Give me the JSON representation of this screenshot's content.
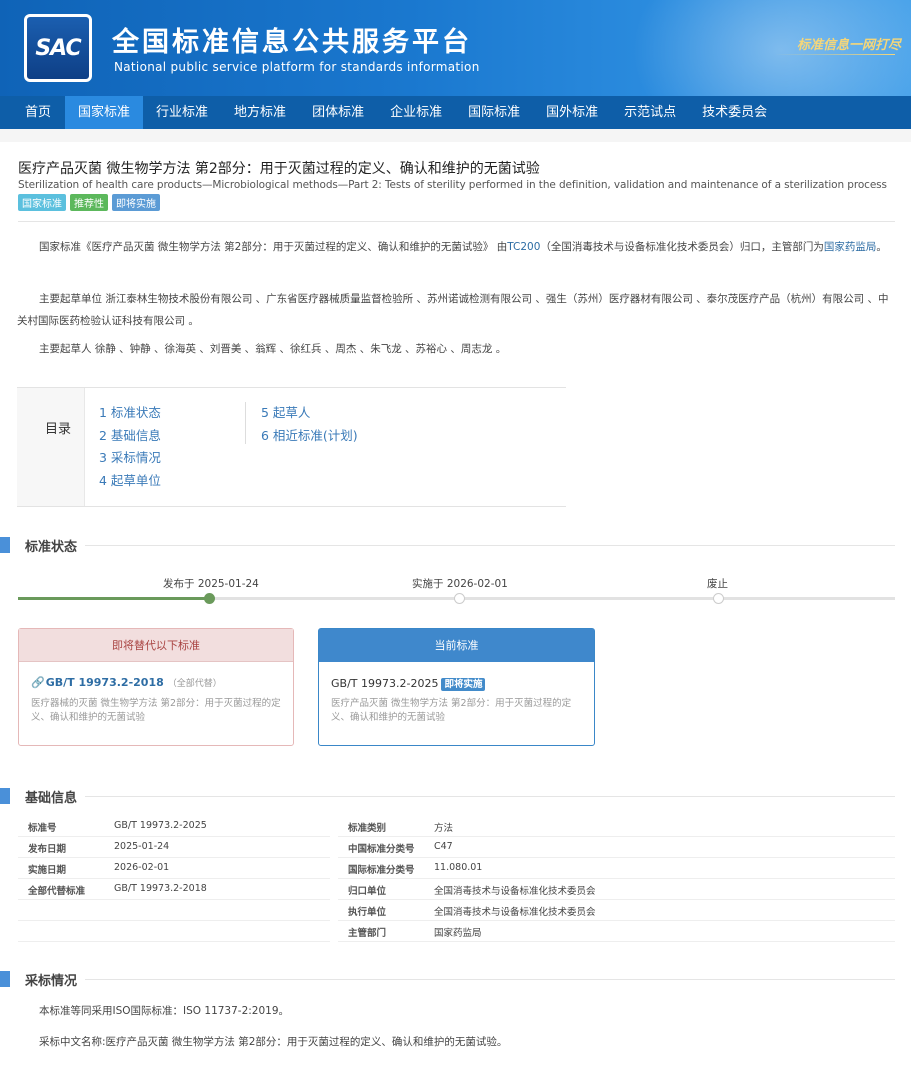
{
  "header": {
    "logo_text": "SAC",
    "title": "全国标准信息公共服务平台",
    "subtitle": "National public service platform  for standards information",
    "slogan": "标准信息一网打尽"
  },
  "nav": {
    "items": [
      "首页",
      "国家标准",
      "行业标准",
      "地方标准",
      "团体标准",
      "企业标准",
      "国际标准",
      "国外标准",
      "示范试点",
      "技术委员会"
    ],
    "active_index": 1
  },
  "standard": {
    "title_cn": "医疗产品灭菌 微生物学方法 第2部分：用于灭菌过程的定义、确认和维护的无菌试验",
    "title_en": "Sterilization of health care products—Microbiological methods—Part 2: Tests of sterility performed in the definition, validation and maintenance of a sterilization process",
    "badges": [
      "国家标准",
      "推荐性",
      "即将实施"
    ]
  },
  "intro": {
    "p1_a": "国家标准《医疗产品灭菌 微生物学方法 第2部分：用于灭菌过程的定义、确认和维护的无菌试验》 由",
    "p1_link1": "TC200",
    "p1_b": "（全国消毒技术与设备标准化技术委员会）归口，主管部门为",
    "p1_link2": "国家药监局",
    "p1_c": "。",
    "p2": "主要起草单位 浙江泰林生物技术股份有限公司 、广东省医疗器械质量监督检验所 、苏州诺诚检测有限公司 、强生（苏州）医疗器材有限公司 、泰尔茂医疗产品（杭州）有限公司 、中关村国际医药检验认证科技有限公司 。",
    "p3": "主要起草人 徐静 、钟静 、徐海英 、刘晋美 、翁辉 、徐红兵 、周杰 、朱飞龙 、苏裕心 、周志龙 。"
  },
  "toc": {
    "label": "目录",
    "col1": [
      "1  标准状态",
      "2  基础信息",
      "3  采标情况",
      "4  起草单位"
    ],
    "col2": [
      "5  起草人",
      "6  相近标准(计划)"
    ]
  },
  "sections": {
    "status": "标准状态",
    "basic": "基础信息",
    "adopt": "采标情况"
  },
  "timeline": {
    "steps": [
      "发布于 2025-01-24",
      "实施于 2026-02-01",
      "废止"
    ],
    "completed": 1
  },
  "cards": {
    "replace": {
      "head": "即将替代以下标准",
      "code": "GB/T 19973.2-2018",
      "note": "（全部代替）",
      "desc": "医疗器械的灭菌 微生物学方法 第2部分：用于灭菌过程的定义、确认和维护的无菌试验"
    },
    "current": {
      "head": "当前标准",
      "code": "GB/T 19973.2-2025",
      "tag": "即将实施",
      "desc": "医疗产品灭菌 微生物学方法 第2部分：用于灭菌过程的定义、确认和维护的无菌试验"
    }
  },
  "basic_info": {
    "left": [
      {
        "k": "标准号",
        "v": "GB/T 19973.2-2025"
      },
      {
        "k": "发布日期",
        "v": "2025-01-24"
      },
      {
        "k": "实施日期",
        "v": "2026-02-01"
      },
      {
        "k": "全部代替标准",
        "v": "GB/T 19973.2-2018"
      }
    ],
    "right": [
      {
        "k": "标准类别",
        "v": "方法"
      },
      {
        "k": "中国标准分类号",
        "v": "C47"
      },
      {
        "k": "国际标准分类号",
        "v": "11.080.01"
      },
      {
        "k": "归口单位",
        "v": "全国消毒技术与设备标准化技术委员会"
      },
      {
        "k": "执行单位",
        "v": "全国消毒技术与设备标准化技术委员会"
      },
      {
        "k": "主管部门",
        "v": "国家药监局"
      }
    ]
  },
  "adopt": {
    "p1": "本标准等同采用ISO国际标准：ISO 11737-2:2019。",
    "p2": "采标中文名称:医疗产品灭菌 微生物学方法 第2部分：用于灭菌过程的定义、确认和维护的无菌试验。"
  },
  "colors": {
    "nav_bg": "#0e5ea8",
    "nav_active": "#2a8ae0",
    "link": "#2e6da4",
    "section_bar": "#4a90d9",
    "timeline_done": "#6a9a5b"
  }
}
